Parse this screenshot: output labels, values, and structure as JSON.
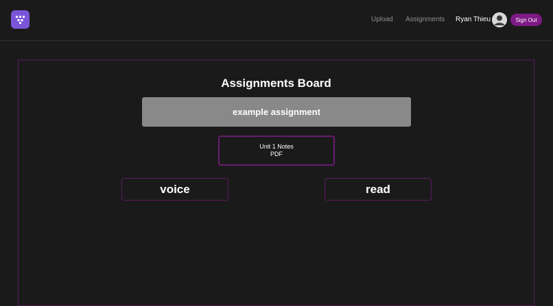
{
  "header": {
    "logo_icon": "smiley-grid-icon",
    "nav": [
      {
        "label": "Upload"
      },
      {
        "label": "Assignments"
      }
    ],
    "user_name": "Ryan Thieu",
    "avatar_icon": "user-avatar-icon",
    "sign_out_label": "Sign Out"
  },
  "board": {
    "title": "Assignments Board",
    "assignment_name": "example assignment",
    "file": {
      "name": "Unit 1 Notes",
      "type": "PDF"
    },
    "actions": {
      "voice_label": "voice",
      "read_label": "read"
    }
  },
  "colors": {
    "background": "#1b1a1b",
    "accent_purple": "#7e1a86",
    "border_purple": "#5a1a62",
    "logo": "#7b55d9",
    "banner_gray": "#8a898a"
  }
}
